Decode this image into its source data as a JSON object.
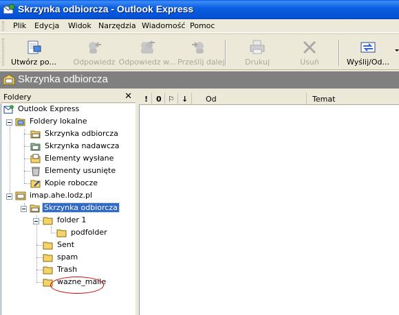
{
  "window": {
    "title": "Skrzynka odbiorcza - Outlook Express"
  },
  "menu": [
    "Plik",
    "Edycja",
    "Widok",
    "Narzędzia",
    "Wiadomość",
    "Pomoc"
  ],
  "toolbar": {
    "compose": "Utwórz po...",
    "reply": "Odpowiedz",
    "reply_all": "Odpowiedz w...",
    "forward": "Prześlij dalej",
    "print": "Drukuj",
    "delete": "Usuń",
    "send_receive": "Wyślij/Od..."
  },
  "folder_header": {
    "title": "Skrzynka odbiorcza"
  },
  "folders_pane": {
    "title": "Foldery",
    "close": "✕"
  },
  "tree": {
    "root": "Outlook Express",
    "local": "Foldery lokalne",
    "local_children": [
      "Skrzynka odbiorcza",
      "Skrzynka nadawcza",
      "Elementy wysłane",
      "Elementy usunięte",
      "Kopie robocze"
    ],
    "imap": "imap.ahe.lodz.pl",
    "imap_inbox": "Skrzynka odbiorcza",
    "folder1": "folder 1",
    "podfolder": "podfolder",
    "imap_others": [
      "Sent",
      "spam",
      "Trash",
      "wazne_maile"
    ]
  },
  "columns": {
    "priority": "!",
    "attachment": "0",
    "flag": "⚐",
    "download": "↓",
    "from": "Od",
    "subject": "Temat"
  },
  "colors": {
    "titlebar": "#0a5ee6",
    "selection": "#316ac5",
    "highlight": "#d40000"
  }
}
